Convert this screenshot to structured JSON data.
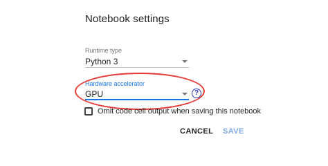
{
  "dialog": {
    "title": "Notebook settings"
  },
  "runtime_type": {
    "label": "Runtime type",
    "value": "Python 3"
  },
  "hardware_accelerator": {
    "label": "Hardware accelerator",
    "value": "GPU",
    "help_icon_text": "?"
  },
  "omit_output": {
    "label": "Omit code cell output when saving this notebook",
    "checked": false
  },
  "buttons": {
    "cancel": "CANCEL",
    "save": "SAVE"
  },
  "colors": {
    "accent": "#1a73e8",
    "annotation": "#e53935",
    "save_disabled": "#7fa8e6"
  }
}
